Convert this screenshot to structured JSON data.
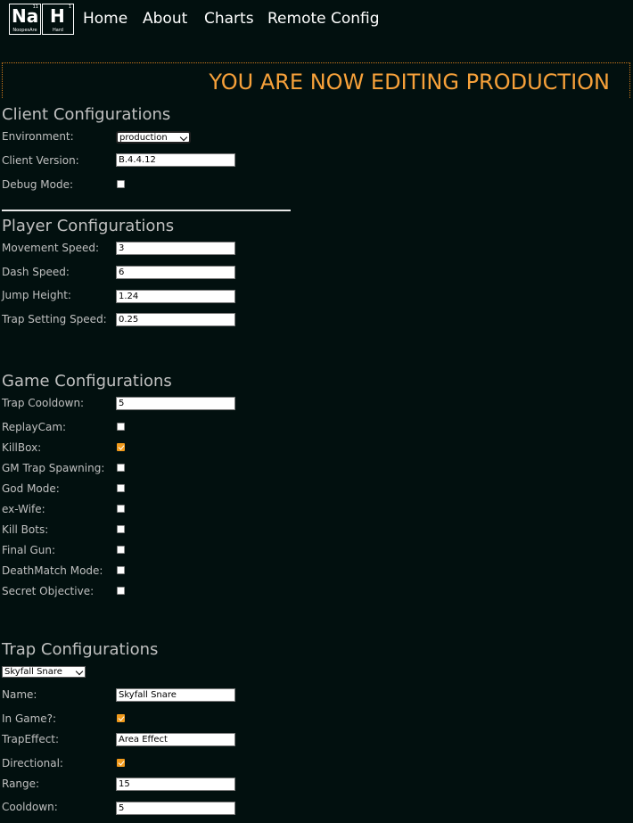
{
  "nav": {
    "logo": {
      "tiles": [
        {
          "symbol": "Na",
          "number": "11",
          "word": "NoopesAre"
        },
        {
          "symbol": "H",
          "number": "1",
          "word": "Hard"
        }
      ]
    },
    "links": [
      "Home",
      "About",
      "Charts",
      "Remote Config"
    ]
  },
  "banner": {
    "text": "YOU ARE NOW EDITING PRODUCTION",
    "color": "#f7a13a"
  },
  "client": {
    "title": "Client Configurations",
    "environment_label": "Environment:",
    "environment_value": "production",
    "version_label": "Client Version:",
    "version_value": "B.4.4.12",
    "debug_label": "Debug Mode:",
    "debug_checked": false
  },
  "player": {
    "title": "Player Configurations",
    "fields": [
      {
        "label": "Movement Speed:",
        "value": "3"
      },
      {
        "label": "Dash Speed:",
        "value": "6"
      },
      {
        "label": "Jump Height:",
        "value": "1.24"
      },
      {
        "label": "Trap Setting Speed:",
        "value": "0.25"
      }
    ]
  },
  "game": {
    "title": "Game Configurations",
    "cooldown_label": "Trap Cooldown:",
    "cooldown_value": "5",
    "toggles": [
      {
        "label": "ReplayCam:",
        "checked": false
      },
      {
        "label": "KillBox:",
        "checked": true
      },
      {
        "label": "GM Trap Spawning:",
        "checked": false
      },
      {
        "label": "God Mode:",
        "checked": false
      },
      {
        "label": "ex-Wife:",
        "checked": false
      },
      {
        "label": "Kill Bots:",
        "checked": false
      },
      {
        "label": "Final Gun:",
        "checked": false
      },
      {
        "label": "DeathMatch Mode:",
        "checked": false
      },
      {
        "label": "Secret Objective:",
        "checked": false
      }
    ]
  },
  "trap": {
    "title": "Trap Configurations",
    "selected_trap": "Skyfall Snare",
    "name_label": "Name:",
    "name_value": "Skyfall Snare",
    "ingame_label": "In Game?:",
    "ingame_checked": true,
    "effect_label": "TrapEffect:",
    "effect_value": "Area Effect",
    "directional_label": "Directional:",
    "directional_checked": true,
    "range_label": "Range:",
    "range_value": "15",
    "cooldown_label": "Cooldown:",
    "cooldown_value": "5"
  },
  "colors": {
    "background": "#02100f",
    "accent": "#f19a1b"
  }
}
